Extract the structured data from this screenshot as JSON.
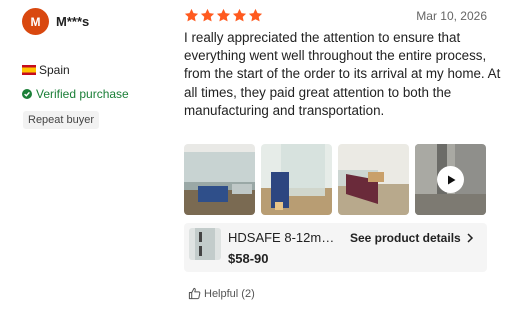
{
  "reviewer": {
    "avatar_initial": "M",
    "name": "M***s",
    "country": "Spain",
    "verified_label": "Verified purchase",
    "badge": "Repeat buyer"
  },
  "review": {
    "rating": 5,
    "date": "Mar 10, 2026",
    "text": "I really appreciated the attention to ensure that everything went well throughout the entire process, from the start of the order to its arrival at my home. At all times, they paid great attention to both the manufacturing and transportation."
  },
  "photos": [
    {
      "kind": "image",
      "icon": "photo-1"
    },
    {
      "kind": "image",
      "icon": "photo-2"
    },
    {
      "kind": "image",
      "icon": "photo-3"
    },
    {
      "kind": "video",
      "icon": "play-icon"
    }
  ],
  "product": {
    "name": "HDSAFE 8-12mm...",
    "price": "$58-90",
    "details_label": "See product details"
  },
  "helpful": {
    "label": "Helpful (2)"
  },
  "colors": {
    "accent": "#ff5a1f",
    "avatar": "#d9480f",
    "verified": "#1a7f37"
  }
}
